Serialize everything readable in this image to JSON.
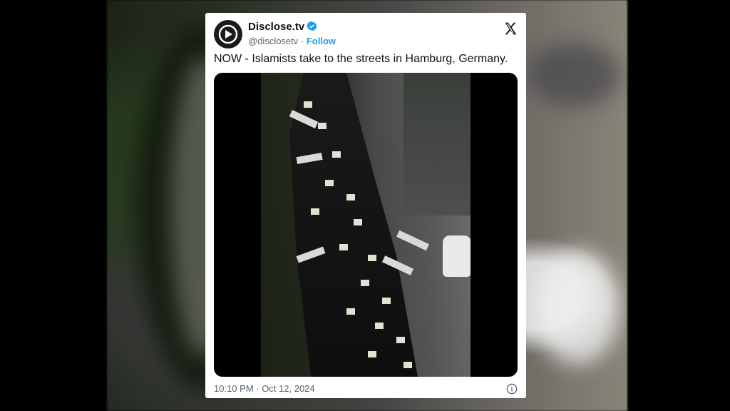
{
  "tweet": {
    "display_name": "Disclose.tv",
    "handle": "@disclosetv",
    "separator": " · ",
    "follow_label": "Follow",
    "text": "NOW - Islamists take to the streets in Hamburg, Germany.",
    "timestamp": "10:10 PM · Oct 12, 2024",
    "icons": {
      "avatar": "disclose-logo-icon",
      "verified": "verified-badge-icon",
      "platform": "x-logo-icon",
      "info": "info-icon"
    }
  },
  "colors": {
    "accent": "#1d9bf0",
    "text": "#0f1419",
    "muted": "#536471"
  }
}
